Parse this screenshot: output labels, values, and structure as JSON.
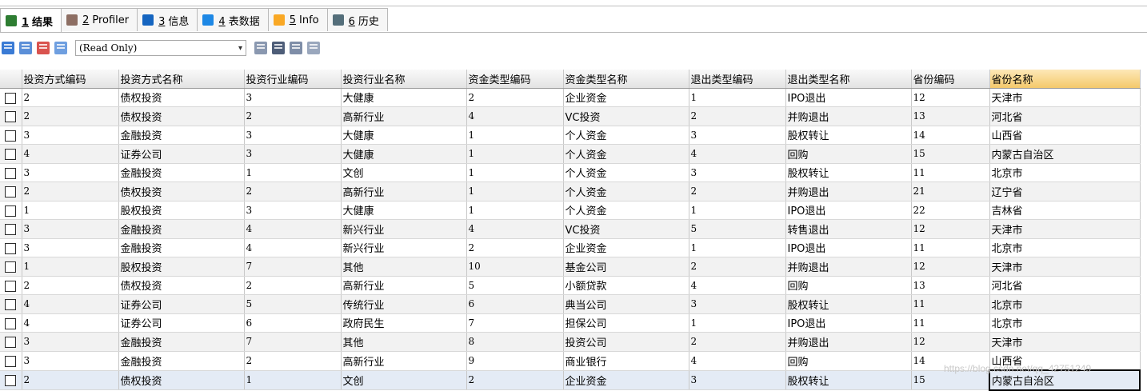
{
  "tabs": [
    {
      "num": "1",
      "label": "结果",
      "icon": "result-grid-icon",
      "color": "#2e7d32",
      "active": true
    },
    {
      "num": "2",
      "label": "Profiler",
      "icon": "profiler-icon",
      "color": "#8d6e63",
      "active": false
    },
    {
      "num": "3",
      "label": "信息",
      "icon": "info-icon",
      "color": "#1565c0",
      "active": false
    },
    {
      "num": "4",
      "label": "表数据",
      "icon": "table-data-icon",
      "color": "#1e88e5",
      "active": false
    },
    {
      "num": "5",
      "label": "Info",
      "icon": "info-chart-icon",
      "color": "#f9a825",
      "active": false
    },
    {
      "num": "6",
      "label": "历史",
      "icon": "history-icon",
      "color": "#546e7a",
      "active": false
    }
  ],
  "toolbar": {
    "mode_select": "(Read Only)",
    "left_icons": [
      "add-row-icon",
      "copy-row-icon",
      "delete-row-icon",
      "refresh-row-icon"
    ],
    "right_icons": [
      "export-icon",
      "save-icon",
      "print-icon",
      "filter-icon"
    ]
  },
  "grid": {
    "columns": [
      "投资方式编码",
      "投资方式名称",
      "投资行业编码",
      "投资行业名称",
      "资金类型编码",
      "资金类型名称",
      "退出类型编码",
      "退出类型名称",
      "省份编码",
      "省份名称"
    ],
    "rows": [
      [
        "2",
        "债权投资",
        "3",
        "大健康",
        "2",
        "企业资金",
        "1",
        "IPO退出",
        "12",
        "天津市"
      ],
      [
        "2",
        "债权投资",
        "2",
        "高新行业",
        "4",
        "VC投资",
        "2",
        "并购退出",
        "13",
        "河北省"
      ],
      [
        "3",
        "金融投资",
        "3",
        "大健康",
        "1",
        "个人资金",
        "3",
        "股权转让",
        "14",
        "山西省"
      ],
      [
        "4",
        "证券公司",
        "3",
        "大健康",
        "1",
        "个人资金",
        "4",
        "回购",
        "15",
        "内蒙古自治区"
      ],
      [
        "3",
        "金融投资",
        "1",
        "文创",
        "1",
        "个人资金",
        "3",
        "股权转让",
        "11",
        "北京市"
      ],
      [
        "2",
        "债权投资",
        "2",
        "高新行业",
        "1",
        "个人资金",
        "2",
        "并购退出",
        "21",
        "辽宁省"
      ],
      [
        "1",
        "股权投资",
        "3",
        "大健康",
        "1",
        "个人资金",
        "1",
        "IPO退出",
        "22",
        "吉林省"
      ],
      [
        "3",
        "金融投资",
        "4",
        "新兴行业",
        "4",
        "VC投资",
        "5",
        "转售退出",
        "12",
        "天津市"
      ],
      [
        "3",
        "金融投资",
        "4",
        "新兴行业",
        "2",
        "企业资金",
        "1",
        "IPO退出",
        "11",
        "北京市"
      ],
      [
        "1",
        "股权投资",
        "7",
        "其他",
        "10",
        "基金公司",
        "2",
        "并购退出",
        "12",
        "天津市"
      ],
      [
        "2",
        "债权投资",
        "2",
        "高新行业",
        "5",
        "小额贷款",
        "4",
        "回购",
        "13",
        "河北省"
      ],
      [
        "4",
        "证券公司",
        "5",
        "传统行业",
        "6",
        "典当公司",
        "3",
        "股权转让",
        "11",
        "北京市"
      ],
      [
        "4",
        "证券公司",
        "6",
        "政府民生",
        "7",
        "担保公司",
        "1",
        "IPO退出",
        "11",
        "北京市"
      ],
      [
        "3",
        "金融投资",
        "7",
        "其他",
        "8",
        "投资公司",
        "2",
        "并购退出",
        "12",
        "天津市"
      ],
      [
        "3",
        "金融投资",
        "2",
        "高新行业",
        "9",
        "商业银行",
        "4",
        "回购",
        "14",
        "山西省"
      ],
      [
        "2",
        "债权投资",
        "1",
        "文创",
        "2",
        "企业资金",
        "3",
        "股权转让",
        "15",
        "内蒙古自治区"
      ]
    ]
  },
  "watermark": "https://blog.csdn.net/qq_42751249"
}
